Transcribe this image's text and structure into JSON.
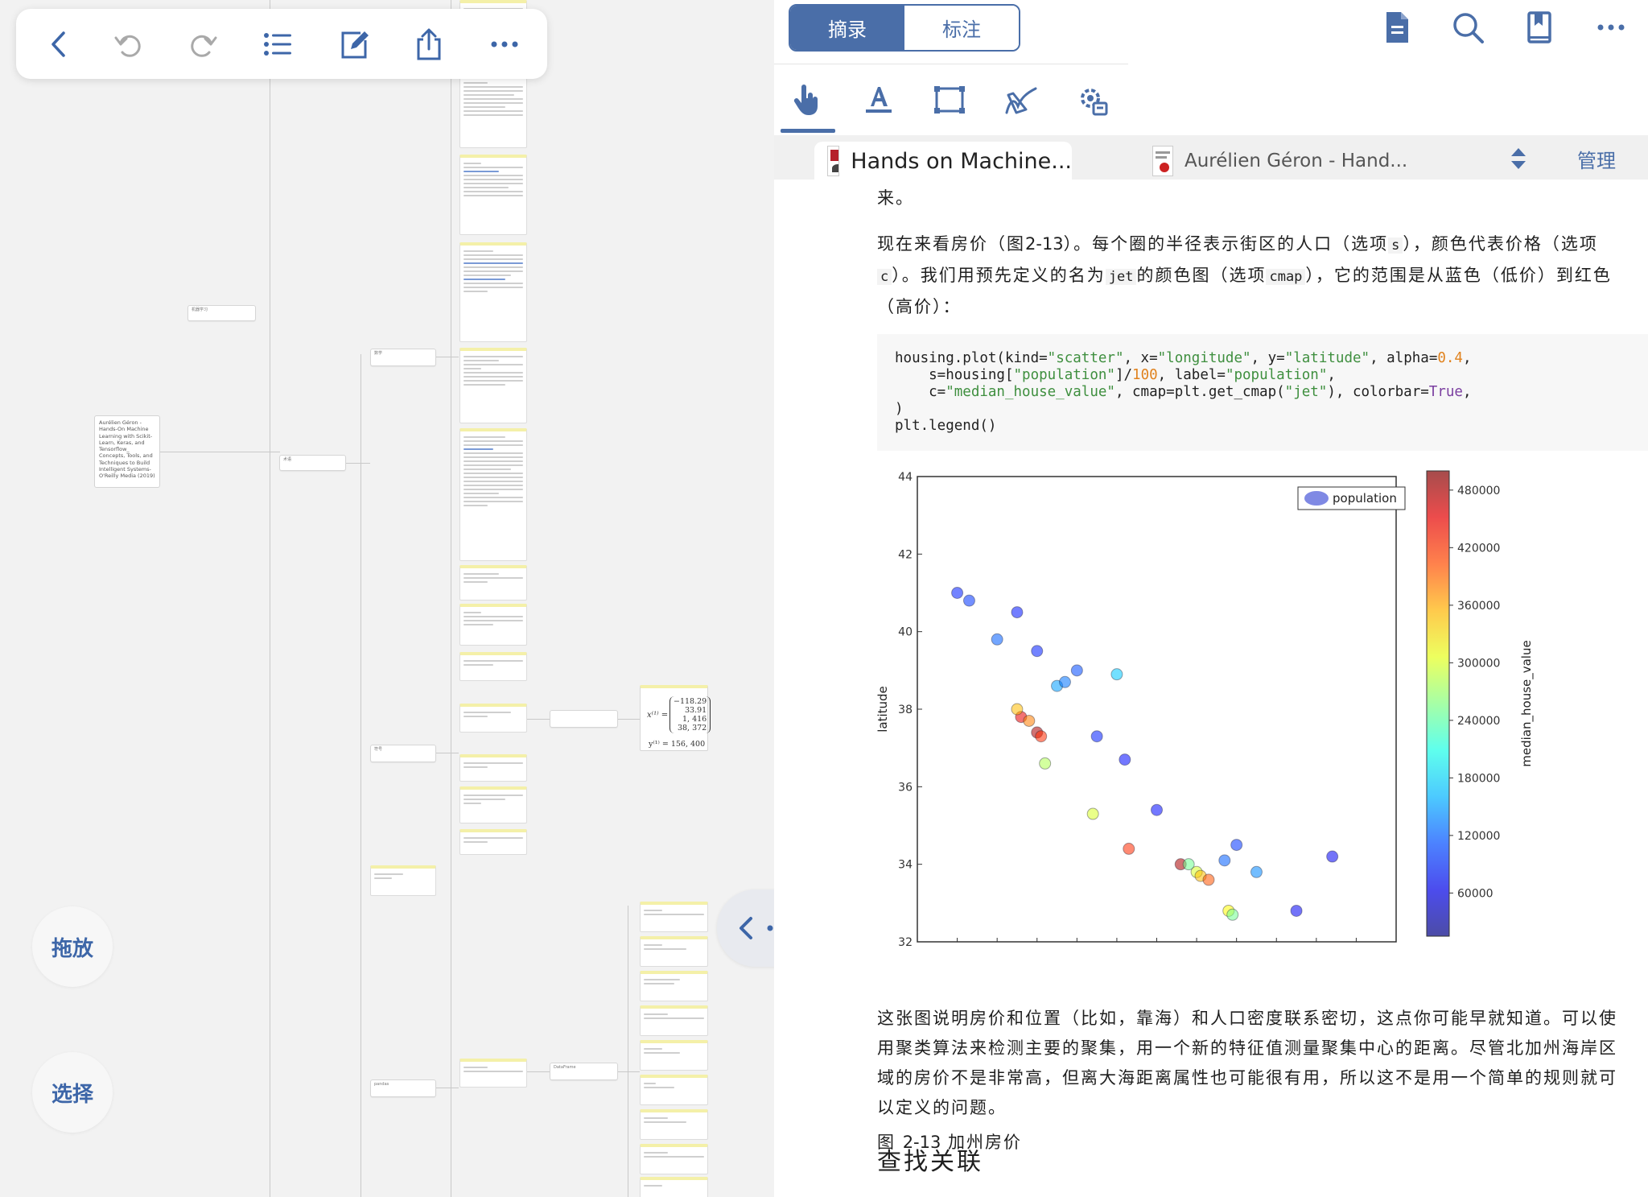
{
  "mindmap": {
    "book_node": "Aurélien Géron - Hands-On Machine Learning with Scikit-Learn, Keras, and Tensorflow_ Concepts, Tools, and Techniques to Build Intelligent Systems-O'Reilly Media (2019)",
    "nodes": {
      "ml": "机器学习",
      "intro": "术语",
      "math": "数学",
      "symbol": "符号",
      "pandas": "pandas",
      "dataframe": "DataFrame",
      "notes_head": "Jupyter",
      "note_read": "读取为DataFrame"
    },
    "formula": {
      "x_label": "x⁽¹⁾ =",
      "vector": [
        "−118.29",
        "33.91",
        "1, 416",
        "38, 372"
      ],
      "y_label": "y⁽¹⁾ = 156, 400"
    }
  },
  "toolbar": {
    "back": "back-icon",
    "undo": "undo-icon",
    "redo": "redo-icon",
    "outline": "list-icon",
    "edit": "edit-icon",
    "share": "share-icon",
    "more": "more-icon"
  },
  "side_buttons": {
    "drag": "拖放",
    "select": "选择"
  },
  "right_panel": {
    "segments": {
      "excerpt": "摘录",
      "annotate": "标注"
    },
    "manage": "管理",
    "tabs": [
      {
        "label": "Hands on Machine..."
      },
      {
        "label": "Aurélien Géron - Hand..."
      }
    ]
  },
  "document": {
    "top_fragment": "来。",
    "para1_a": "现在来看房价（图",
    "para1_fig": "2-13",
    "para1_b": "）。每个圈的半径表示街区的人口（选项",
    "code_s": "s",
    "para1_c": "），颜色代表价格（选项",
    "code_c": "c",
    "para1_d": "）。我们用预先定义的名为",
    "code_jet": "jet",
    "para1_e": "的颜色图（选项",
    "code_cmap": "cmap",
    "para1_f": "），它的范围是从蓝色（低价）到红色（高价）：",
    "caption_prefix": "图",
    "caption_num": "2-13",
    "caption_text": "加州房价",
    "para2": "这张图说明房价和位置（比如，靠海）和人口密度联系密切，这点你可能早就知道。可以使用聚类算法来检测主要的聚集，用一个新的特征值测量聚集中心的距离。尽管北加州海岸区域的房价不是非常高，但离大海距离属性也可能很有用，所以这不是用一个简单的规则就可以定义的问题。",
    "section_heading": "查找关联"
  },
  "chart_data": {
    "type": "scatter",
    "xlabel": "",
    "ylabel": "latitude",
    "ylim": [
      32,
      44
    ],
    "y_ticks": [
      32,
      34,
      36,
      38,
      40,
      42,
      44
    ],
    "legend": {
      "label": "population",
      "placement": "top-right"
    },
    "colorbar": {
      "label": "median_house_value",
      "ticks": [
        60000,
        120000,
        180000,
        240000,
        300000,
        360000,
        420000,
        480000
      ],
      "colormap": "jet"
    },
    "series": [
      {
        "values_note": "approximate points (longitude, latitude, value)",
        "points": [
          [
            -122.4,
            37.8,
            450000
          ],
          [
            -122.2,
            37.7,
            380000
          ],
          [
            -122.0,
            37.4,
            480000
          ],
          [
            -121.9,
            37.3,
            420000
          ],
          [
            -122.5,
            38.0,
            350000
          ],
          [
            -121.5,
            38.6,
            150000
          ],
          [
            -121.3,
            38.7,
            130000
          ],
          [
            -121.0,
            39.0,
            110000
          ],
          [
            -122.0,
            39.5,
            90000
          ],
          [
            -123.0,
            39.8,
            120000
          ],
          [
            -123.7,
            40.8,
            100000
          ],
          [
            -124.0,
            41.0,
            90000
          ],
          [
            -122.5,
            40.5,
            85000
          ],
          [
            -120.5,
            37.3,
            90000
          ],
          [
            -119.8,
            36.7,
            80000
          ],
          [
            -119.0,
            35.4,
            80000
          ],
          [
            -120.6,
            35.3,
            300000
          ],
          [
            -119.7,
            34.4,
            420000
          ],
          [
            -118.4,
            34.0,
            480000
          ],
          [
            -118.2,
            34.0,
            250000
          ],
          [
            -118.0,
            33.8,
            300000
          ],
          [
            -117.9,
            33.7,
            350000
          ],
          [
            -117.7,
            33.6,
            400000
          ],
          [
            -117.2,
            32.8,
            320000
          ],
          [
            -117.1,
            32.7,
            250000
          ],
          [
            -117.3,
            34.1,
            120000
          ],
          [
            -116.5,
            33.8,
            140000
          ],
          [
            -115.5,
            32.8,
            70000
          ],
          [
            -114.6,
            34.2,
            70000
          ],
          [
            -121.8,
            36.6,
            280000
          ],
          [
            -120.0,
            38.9,
            170000
          ],
          [
            -117.0,
            34.5,
            100000
          ]
        ]
      }
    ]
  }
}
